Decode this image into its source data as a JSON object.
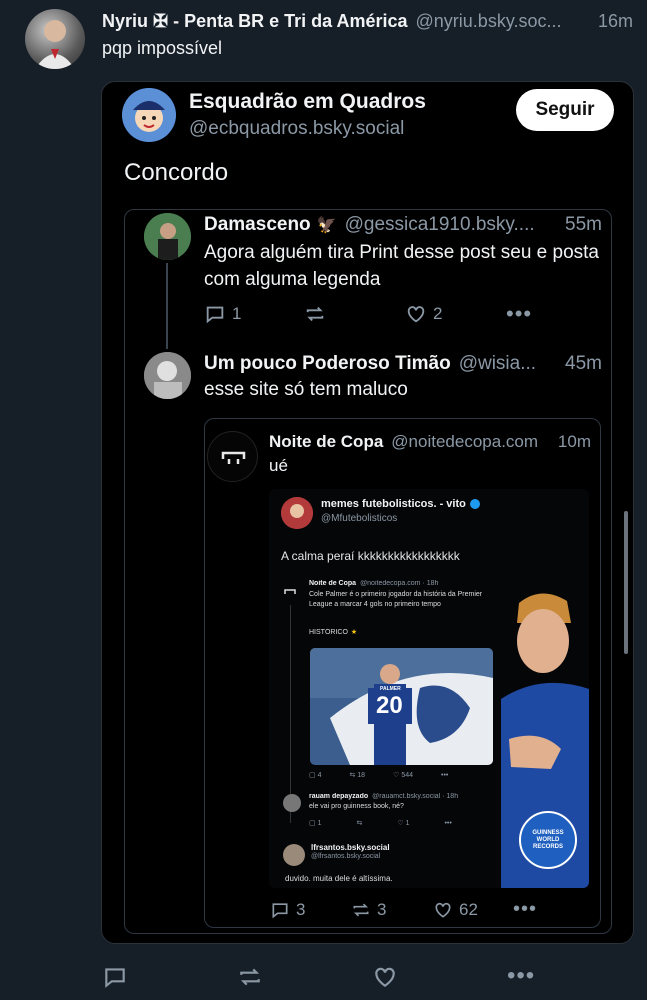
{
  "outer_post": {
    "author_name": "Nyriu ✠ - Penta BR e Tri da América",
    "handle": "@nyriu.bsky.soc...",
    "time": "16m",
    "text": "pqp impossível"
  },
  "screenshot": {
    "author_name": "Esquadrão em Quadros",
    "handle": "@ecbquadros.bsky.social",
    "follow_label": "Seguir",
    "text": "Concordo",
    "reply1": {
      "author_name": "Damasceno",
      "handle": "@gessica1910.bsky....",
      "time": "55m",
      "text": "Agora alguém tira Print desse post seu e posta com alguma legenda",
      "replies": "1",
      "likes": "2"
    },
    "reply2": {
      "author_name": "Um pouco Poderoso Timão",
      "handle": "@wisia...",
      "time": "45m",
      "text": "esse site só tem maluco"
    },
    "quote": {
      "author_name": "Noite de Copa",
      "handle": "@noitedecopa.com",
      "time": "10m",
      "text": "ué",
      "replies": "3",
      "reposts": "3",
      "likes": "62",
      "image": {
        "author_name": "memes futebolisticos. - vito",
        "handle": "@Mfutebolisticos",
        "text": "A calma peraí kkkkkkkkkkkkkkkkk",
        "nested_author": "Noite de Copa",
        "nested_handle": "@noitedecopa.com · 18h",
        "nested_text": "Cole Palmer é o primeiro jogador da história da Premier League a marcar 4 gols no primeiro tempo",
        "nested_tag": "HISTÓRICO",
        "nested_stats": [
          "4",
          "18",
          "544"
        ],
        "reply_author": "rauam depayzado",
        "reply_handle": "@rauamct.bsky.social · 18h",
        "reply_text": "ele vai pro guinness book, né?",
        "reply_stats": [
          "1",
          "1"
        ],
        "last_author": "lfrsantos.bsky.social",
        "last_handle": "@lfrsantos.bsky.social",
        "last_text": "duvido. muita dele é altíssima.",
        "badge_text": "GUINNESS WORLD RECORDS",
        "jersey_name": "PALMER",
        "jersey_number": "20"
      }
    }
  },
  "action_bar": {
    "icons": [
      "reply-icon",
      "repost-icon",
      "like-icon",
      "more-icon"
    ]
  },
  "colors": {
    "background": "#161e27",
    "screenshot_bg": "#000000",
    "muted": "#8b98a5"
  }
}
